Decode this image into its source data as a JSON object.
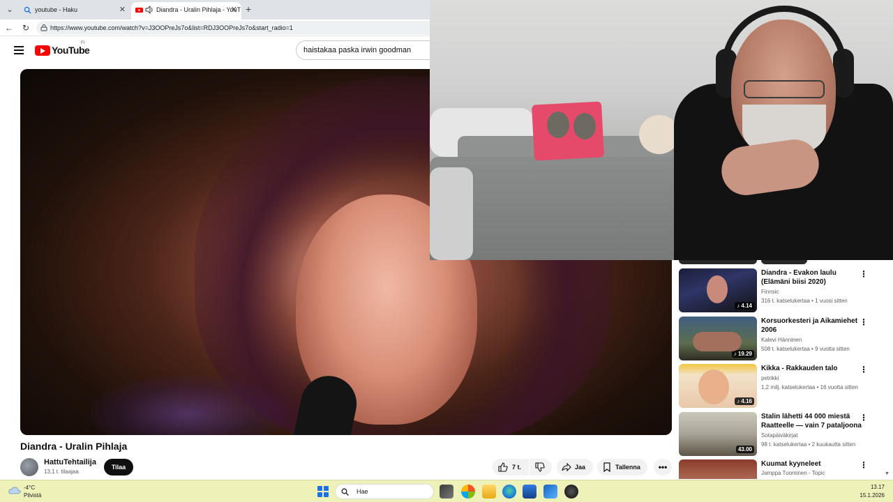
{
  "browser": {
    "tabs": [
      {
        "title": "youtube - Haku"
      },
      {
        "title": "Diandra - Uralin Pihlaja - YouT"
      }
    ],
    "url": "https://www.youtube.com/watch?v=J3OOPreJs7o&list=RDJ3OOPreJs7o&start_radio=1"
  },
  "youtube": {
    "logo_text": "YouTube",
    "country_code": "FI",
    "search_query": "haistakaa paska irwin goodman"
  },
  "video": {
    "title": "Diandra - Uralin Pihlaja",
    "channel": "HattuTehtailija",
    "subscribers": "13,1 t. tilaajaa",
    "subscribe_label": "Tilaa",
    "likes": "7 t.",
    "share_label": "Jaa",
    "save_label": "Tallenna",
    "more_label": "•••"
  },
  "recommendations": [
    {
      "title": "Diandra - Evakon laulu (Elämäni biisi 2020)",
      "channel": "Finnsic",
      "meta": "316 t. katselukertaa • 1 vuosi sitten",
      "duration": "♪ 4.14"
    },
    {
      "title": "Korsuorkesteri ja Aikamiehet 2006",
      "channel": "Kalevi Hänninen",
      "meta": "508 t. katselukertaa • 9 vuotta sitten",
      "duration": "♪ 19.29"
    },
    {
      "title": "Kikka - Rakkauden talo",
      "channel": "petrikki",
      "meta": "1,2 milj. katselukertaa • 16 vuotta sitten",
      "duration": "♪ 4.16"
    },
    {
      "title": "Stalin lähetti 44 000 miestä Raatteelle — vain 7 pataljoona ...",
      "channel": "Sotapäiväkirjat",
      "meta": "98 t. katselukertaa • 2 kuukautta sitten",
      "duration": "43.00"
    },
    {
      "title": "Kuumat kyyneleet",
      "channel": "Jamppa Tuominen - Topic",
      "meta": "",
      "duration": ""
    }
  ],
  "taskbar": {
    "temperature": "-4°C",
    "condition": "Pilvistä",
    "search_placeholder": "Hae",
    "time": "13.17",
    "date": "15.1.2026"
  },
  "colors": {
    "youtube_red": "#ff0000",
    "taskbar_bg": "#eef1b8",
    "subscribe_bg": "#0f0f0f"
  }
}
